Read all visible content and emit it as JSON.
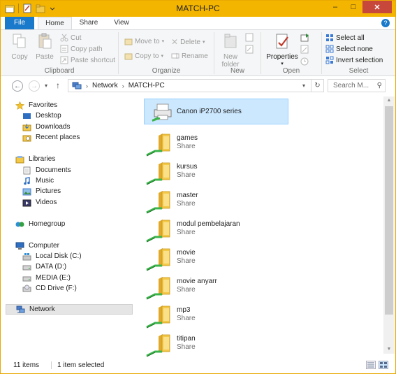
{
  "window": {
    "title": "MATCH-PC",
    "minimize": "–",
    "maximize": "□",
    "close": "✕"
  },
  "tabs": {
    "file": "File",
    "home": "Home",
    "share": "Share",
    "view": "View",
    "help": "?"
  },
  "ribbon": {
    "clipboard": {
      "copy": "Copy",
      "paste": "Paste",
      "cut": "Cut",
      "copy_path": "Copy path",
      "paste_shortcut": "Paste shortcut",
      "label": "Clipboard"
    },
    "organize": {
      "move_to": "Move to",
      "delete": "Delete",
      "copy_to": "Copy to",
      "rename": "Rename",
      "label": "Organize"
    },
    "new": {
      "new_folder_line1": "New",
      "new_folder_line2": "folder",
      "label": "New"
    },
    "open": {
      "properties": "Properties",
      "label": "Open"
    },
    "select": {
      "select_all": "Select all",
      "select_none": "Select none",
      "invert": "Invert selection",
      "label": "Select"
    }
  },
  "address": {
    "crumbs": [
      "Network",
      "MATCH-PC"
    ],
    "search_placeholder": "Search M..."
  },
  "nav": {
    "favorites": {
      "label": "Favorites",
      "items": [
        "Desktop",
        "Downloads",
        "Recent places"
      ]
    },
    "libraries": {
      "label": "Libraries",
      "items": [
        "Documents",
        "Music",
        "Pictures",
        "Videos"
      ]
    },
    "homegroup": "Homegroup",
    "computer": {
      "label": "Computer",
      "items": [
        "Local Disk (C:)",
        "DATA (D:)",
        "MEDIA (E:)",
        "CD Drive (F:)"
      ]
    },
    "network": "Network"
  },
  "content": {
    "printer": "Canon iP2700 series",
    "shares": [
      {
        "name": "games",
        "sub": "Share"
      },
      {
        "name": "kursus",
        "sub": "Share"
      },
      {
        "name": "master",
        "sub": "Share"
      },
      {
        "name": "modul pembelajaran",
        "sub": "Share"
      },
      {
        "name": "movie",
        "sub": "Share"
      },
      {
        "name": "movie anyarr",
        "sub": "Share"
      },
      {
        "name": "mp3",
        "sub": "Share"
      },
      {
        "name": "titipan",
        "sub": "Share"
      }
    ]
  },
  "status": {
    "count": "11 items",
    "selected": "1 item selected"
  },
  "colors": {
    "titlebar": "#f4b500",
    "file_tab": "#1979ca",
    "selection": "#cce8ff",
    "folder": "#f3c94a"
  }
}
